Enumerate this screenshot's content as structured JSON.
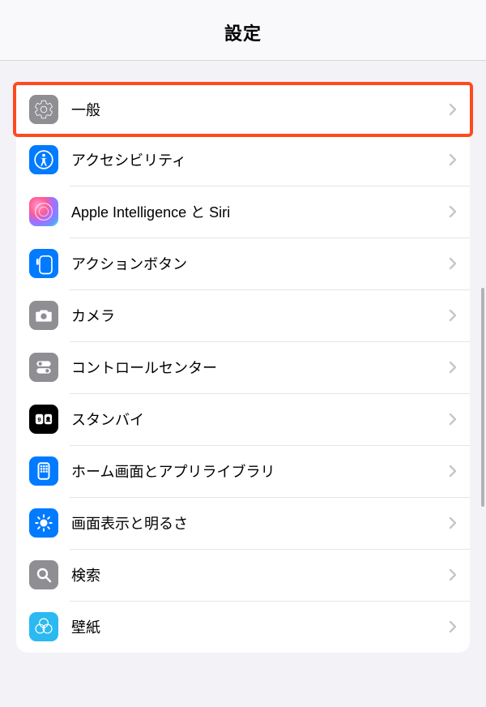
{
  "header": {
    "title": "設定"
  },
  "items": [
    {
      "label": "一般",
      "icon": "general-icon",
      "highlighted": true
    },
    {
      "label": "アクセシビリティ",
      "icon": "accessibility-icon"
    },
    {
      "label": "Apple Intelligence と Siri",
      "icon": "apple-intelligence-icon"
    },
    {
      "label": "アクションボタン",
      "icon": "action-button-icon"
    },
    {
      "label": "カメラ",
      "icon": "camera-icon"
    },
    {
      "label": "コントロールセンター",
      "icon": "control-center-icon"
    },
    {
      "label": "スタンバイ",
      "icon": "standby-icon"
    },
    {
      "label": "ホーム画面とアプリライブラリ",
      "icon": "home-screen-icon"
    },
    {
      "label": "画面表示と明るさ",
      "icon": "display-brightness-icon"
    },
    {
      "label": "検索",
      "icon": "search-icon"
    },
    {
      "label": "壁紙",
      "icon": "wallpaper-icon"
    }
  ],
  "colors": {
    "highlight": "#ff4a1f",
    "background": "#f2f2f7",
    "separator": "#e5e5ea"
  }
}
